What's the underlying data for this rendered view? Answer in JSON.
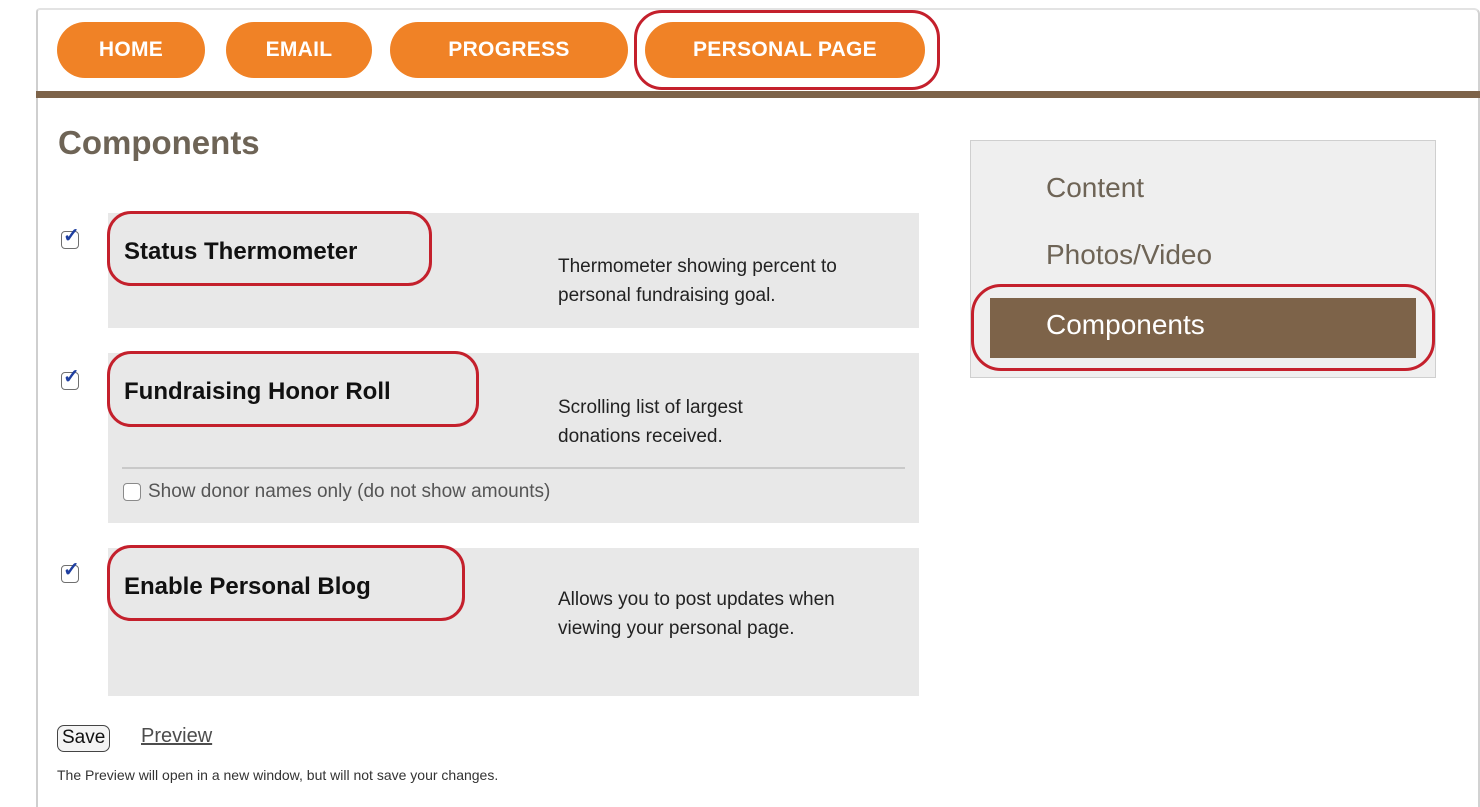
{
  "nav": {
    "tabs": [
      {
        "label": "HOME"
      },
      {
        "label": "EMAIL"
      },
      {
        "label": "PROGRESS"
      },
      {
        "label": "PERSONAL PAGE"
      }
    ]
  },
  "main": {
    "title": "Components",
    "components": [
      {
        "name": "Status Thermometer",
        "description": "Thermometer showing percent to personal fundraising goal.",
        "checked": true
      },
      {
        "name": "Fundraising Honor Roll",
        "description": "Scrolling list of largest donations received.",
        "checked": true,
        "option": {
          "label": "Show donor names only (do not show amounts)",
          "checked": false
        }
      },
      {
        "name": "Enable Personal Blog",
        "description": "Allows you to post updates when viewing your personal page.",
        "checked": true
      }
    ],
    "save_label": "Save",
    "preview_label": "Preview",
    "note": "The Preview will open in a new window, but will not save your changes."
  },
  "sidebar": {
    "items": [
      {
        "label": "Content"
      },
      {
        "label": "Photos/Video"
      },
      {
        "label": "Components",
        "active": true
      }
    ]
  },
  "colors": {
    "tab_orange": "#f08226",
    "brown_accent": "#7d6349",
    "highlight_red": "#c4202c",
    "panel_gray": "#e8e8e8"
  }
}
